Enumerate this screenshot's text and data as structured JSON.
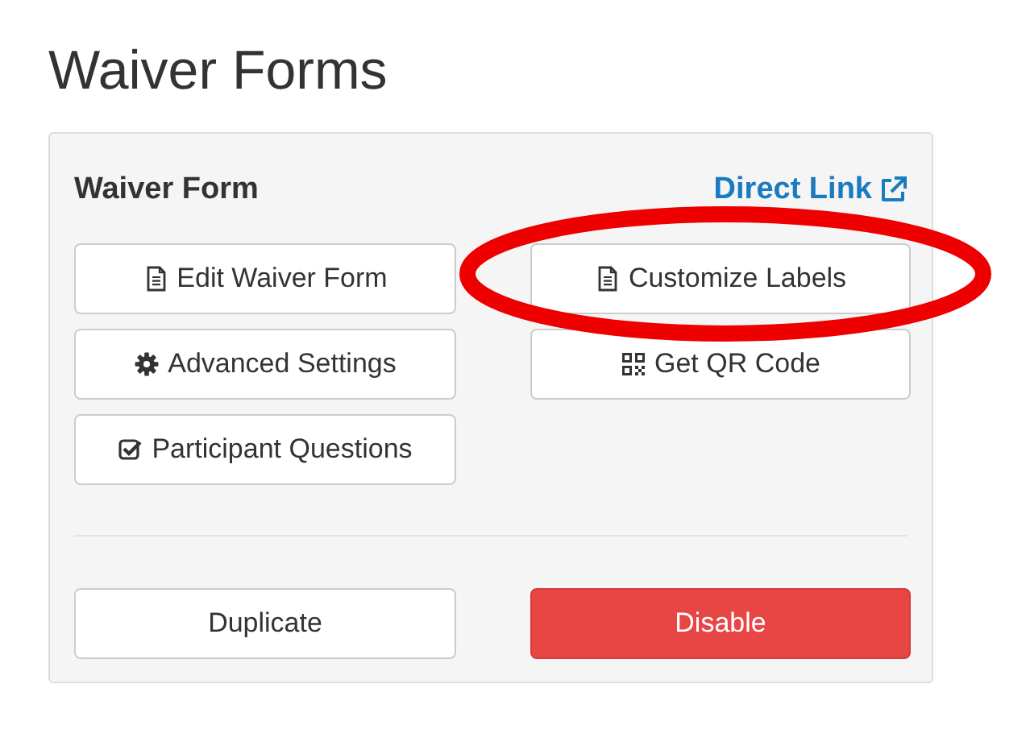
{
  "page": {
    "title": "Waiver Forms"
  },
  "card": {
    "heading": "Waiver Form",
    "direct_link": "Direct Link",
    "buttons": [
      {
        "label": "Edit Waiver Form",
        "kind": "document"
      },
      {
        "label": "Customize Labels",
        "kind": "document"
      },
      {
        "label": "Advanced Settings",
        "kind": "gear"
      },
      {
        "label": "Get QR Code",
        "kind": "qr"
      },
      {
        "label": "Participant Questions",
        "kind": "checkbox"
      }
    ],
    "footer_buttons": [
      {
        "label": "Duplicate",
        "kind": "default"
      },
      {
        "label": "Disable",
        "kind": "danger"
      }
    ]
  },
  "annotations": [
    {
      "kind": "ellipse"
    }
  ]
}
